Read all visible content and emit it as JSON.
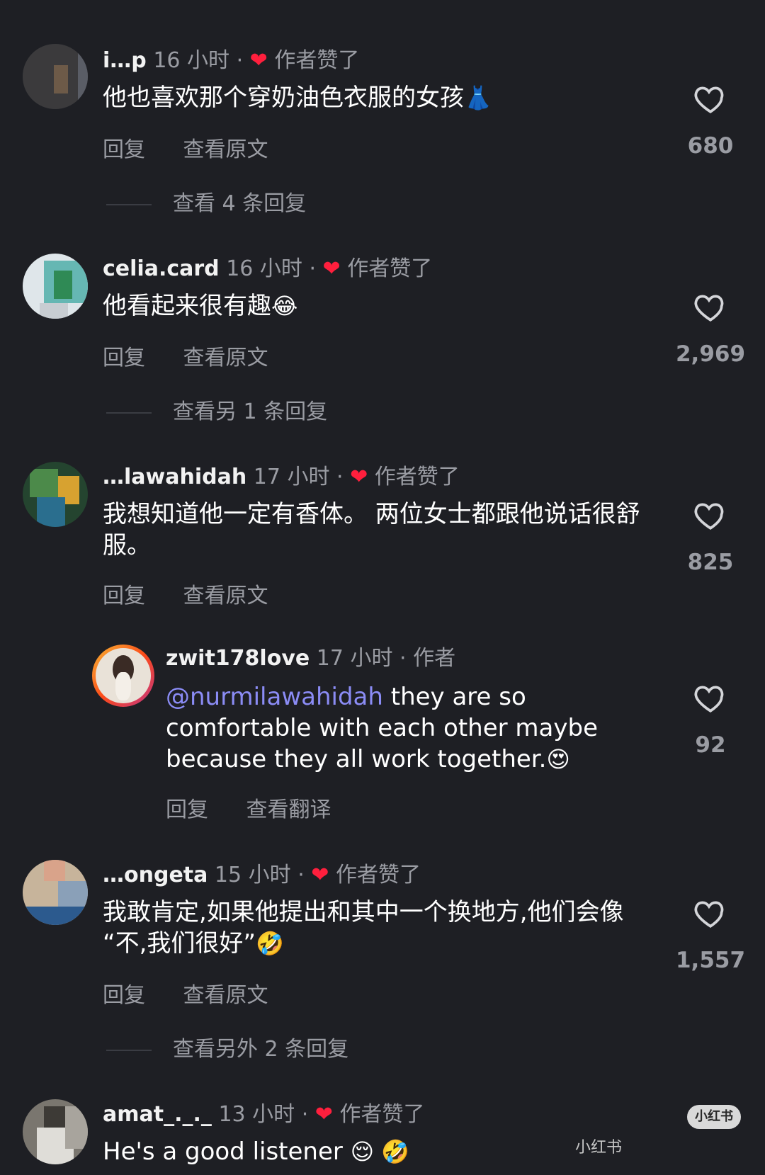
{
  "comments": [
    {
      "username": "i…p",
      "time": "16 小时",
      "author_liked": "作者赞了",
      "text": "他也喜欢那个穿奶油色衣服的女孩",
      "emoji": "👗",
      "reply_label": "回复",
      "view_original": "查看原文",
      "likes": "680",
      "more_replies": "查看 4 条回复"
    },
    {
      "username": "celia.card",
      "time": "16 小时",
      "author_liked": "作者赞了",
      "text": "他看起来很有趣",
      "emoji": "😂",
      "reply_label": "回复",
      "view_original": "查看原文",
      "likes": "2,969",
      "more_replies": "查看另 1 条回复"
    },
    {
      "username": "…lawahidah",
      "time": "17 小时",
      "author_liked": "作者赞了",
      "text": "我想知道他一定有香体。 两位女士都跟他说话很舒服。",
      "reply_label": "回复",
      "view_original": "查看原文",
      "likes": "825"
    },
    {
      "username": "zwit178love",
      "time": "17 小时",
      "author_tag": "作者",
      "mention": "@nurmilawahidah",
      "text": " they are so comfortable with each other maybe because they all work together.",
      "emoji": "😍",
      "reply_label": "回复",
      "view_translation": "查看翻译",
      "likes": "92"
    },
    {
      "username": "…ongeta",
      "time": "15 小时",
      "author_liked": "作者赞了",
      "text": "我敢肯定,如果他提出和其中一个换地方,他们会像 “不,我们很好”",
      "emoji": "🤣",
      "reply_label": "回复",
      "view_original": "查看原文",
      "likes": "1,557",
      "more_replies": "查看另外 2 条回复"
    },
    {
      "username": "amat_._._",
      "time": "13 小时",
      "author_liked": "作者赞了",
      "text": "He's a good listener",
      "emoji": "😌 🤣"
    }
  ],
  "watermark": {
    "badge": "小红书",
    "text": "小红书"
  },
  "colors": {
    "background": "#1e1f24",
    "heart_red": "#ff1f3d",
    "mention": "#8b8cf5",
    "muted": "#9a9ca3"
  }
}
